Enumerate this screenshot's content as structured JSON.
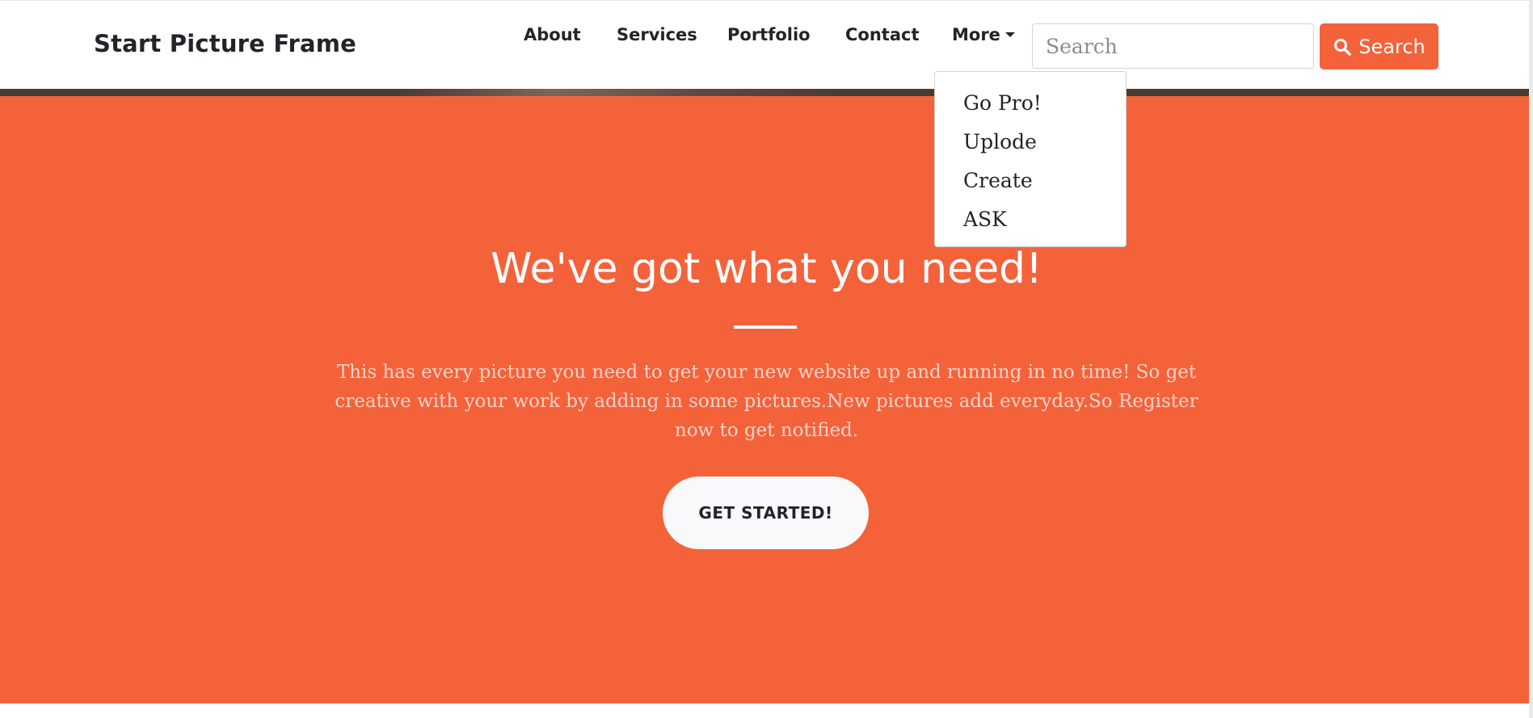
{
  "navbar": {
    "brand": "Start Picture Frame",
    "links": [
      "About",
      "Services",
      "Portfolio",
      "Contact",
      "More"
    ],
    "search": {
      "placeholder": "Search",
      "button_label": "Search"
    }
  },
  "dropdown": {
    "items": [
      "Go Pro!",
      "Uplode",
      "Create",
      "ASK"
    ]
  },
  "hero": {
    "title": "We've got what you need!",
    "text": "This has every picture you need to get your new website up and running in no time! So get creative with your work by adding in some pictures.New pictures add everyday.So Register now to get notified.",
    "cta_label": "GET STARTED!"
  },
  "colors": {
    "primary": "#f4623a",
    "text_dark": "#212529",
    "white": "#ffffff"
  },
  "icons": {
    "search_button_icon": "search-icon",
    "more_caret": "caret-down-icon"
  }
}
